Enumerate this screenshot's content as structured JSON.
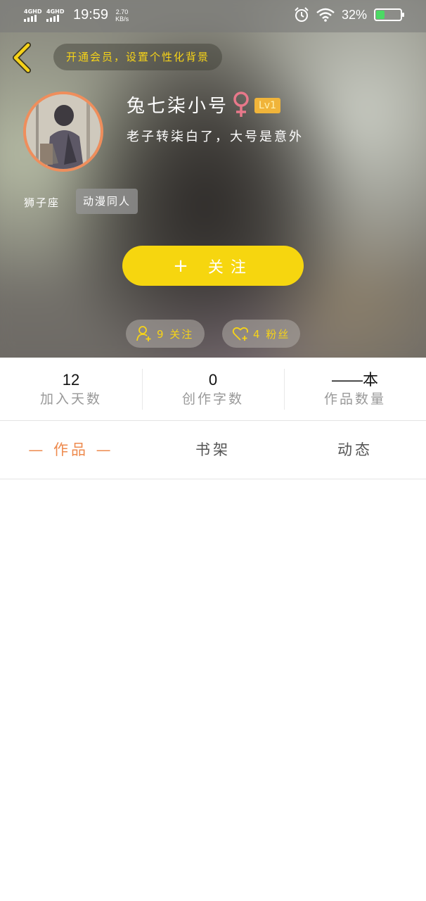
{
  "status_bar": {
    "sim1": "4GHD",
    "sim2": "4GHD",
    "time": "19:59",
    "speed_value": "2.70",
    "speed_unit": "KB/s",
    "battery_text": "32%",
    "battery_level": 0.32,
    "battery_color": "#4cd964"
  },
  "header": {
    "vip_text": "开通会员，设置个性化背景",
    "username": "兔七柒小号",
    "gender_icon": "female-icon",
    "level": "Lv1",
    "bio": "老子转柒白了，大号是意外",
    "zodiac": "狮子座",
    "tag": "动漫同人",
    "follow_plus": "+",
    "follow_label": "关注",
    "following_text": "9 关注",
    "fans_text": "4 粉丝"
  },
  "stats": [
    {
      "value": "12",
      "label": "加入天数"
    },
    {
      "value": "0",
      "label": "创作字数"
    },
    {
      "value": "——本",
      "label": "作品数量"
    }
  ],
  "tabs": [
    {
      "label": "— 作品 —",
      "active": true
    },
    {
      "label": "书架",
      "active": false
    },
    {
      "label": "动态",
      "active": false
    }
  ],
  "colors": {
    "accent_yellow": "#f6d60f",
    "accent_orange": "#ee8a4d",
    "vip_text": "#f6d318",
    "female_pink": "#e8788a"
  }
}
